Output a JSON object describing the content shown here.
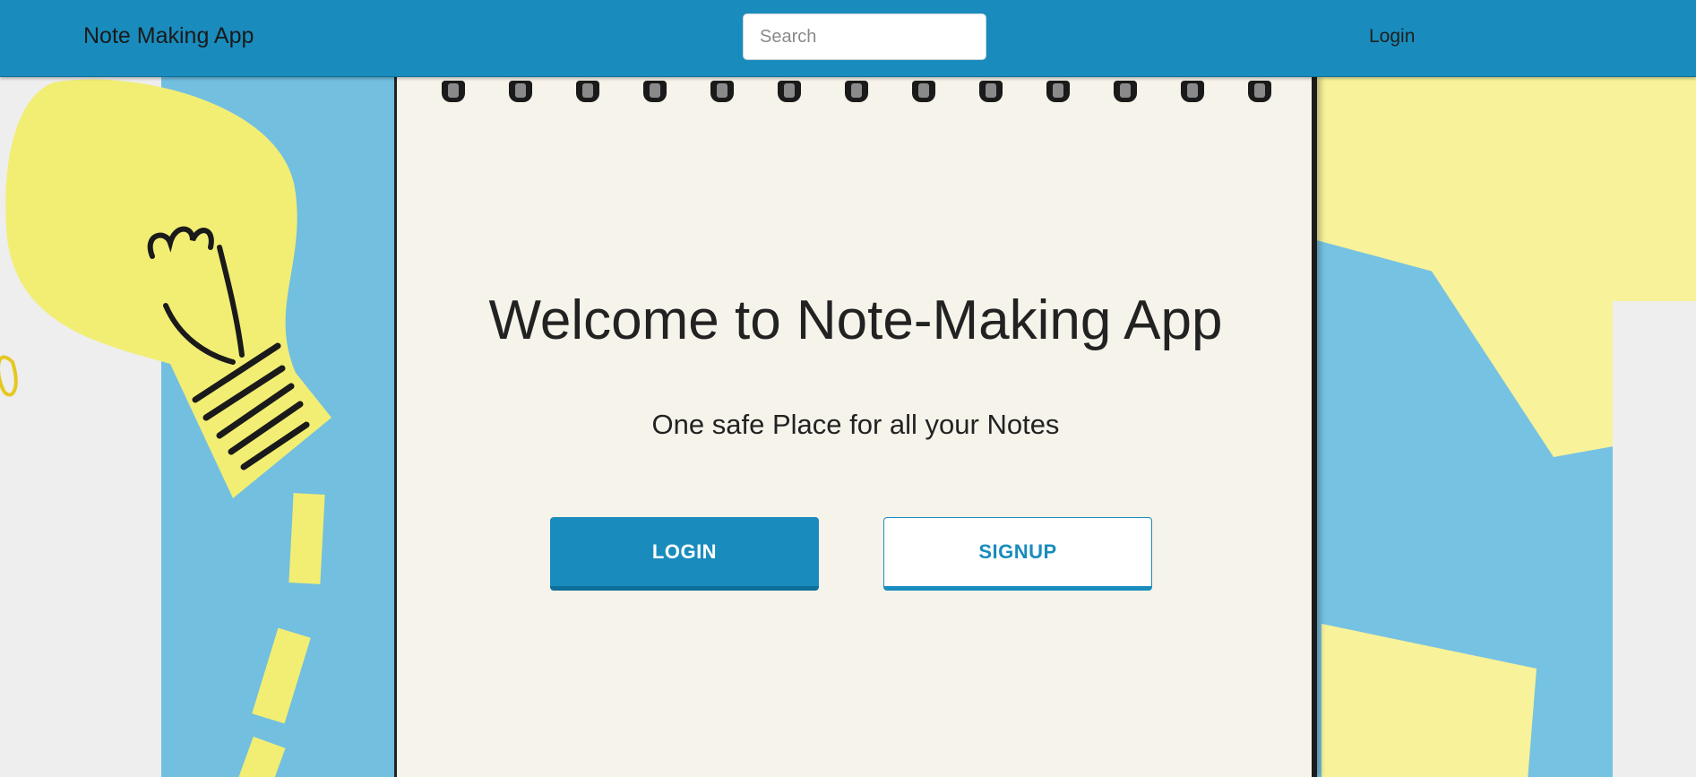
{
  "navbar": {
    "brand": "Note Making App",
    "search_placeholder": "Search",
    "login_link": "Login"
  },
  "hero": {
    "title": "Welcome to Note-Making App",
    "subtitle": "One safe Place for all your Notes",
    "login_button": "LOGIN",
    "signup_button": "SIGNUP"
  },
  "colors": {
    "primary": "#198cbd",
    "paper": "#f6f3ea",
    "yellow": "#f8f29a",
    "blue": "#72bfe0"
  },
  "icons": [
    "lightbulb-illustration",
    "notebook-spiral-rings"
  ]
}
